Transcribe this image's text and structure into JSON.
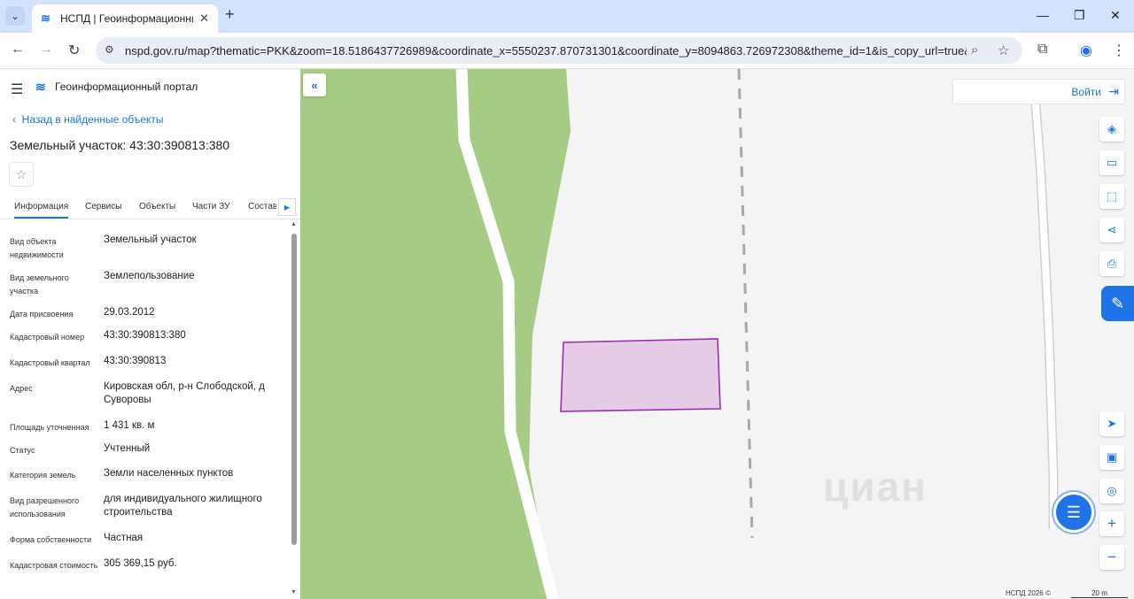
{
  "browser": {
    "tab_title": "НСПД | Геоинформационный",
    "url": "nspd.gov.ru/map?thematic=PKK&zoom=18.5186437726989&coordinate_x=5550237.870731301&coordinate_y=8094863.726972308&theme_id=1&is_copy_url=true&b..."
  },
  "header": {
    "portal_title": "Геоинформационный портал"
  },
  "panel": {
    "back_link": "Назад в найденные объекты",
    "object_title": "Земельный участок: 43:30:390813:380",
    "tabs": [
      "Информация",
      "Сервисы",
      "Объекты",
      "Части ЗУ",
      "Состав"
    ],
    "attributes": [
      {
        "key": "Вид объекта недвижимости",
        "value": "Земельный участок"
      },
      {
        "key": "Вид земельного участка",
        "value": "Землепользование"
      },
      {
        "key": "Дата присвоения",
        "value": "29.03.2012"
      },
      {
        "key": "Кадастровый номер",
        "value": "43:30:390813:380"
      },
      {
        "key": "Кадастровый квартал",
        "value": "43:30:390813"
      },
      {
        "key": "Адрес",
        "value": "Кировская обл, р-н Слободской, д Суворовы"
      },
      {
        "key": "Площадь уточненная",
        "value": "1 431 кв. м"
      },
      {
        "key": "Статус",
        "value": "Учтенный"
      },
      {
        "key": "Категория земель",
        "value": "Земли населенных пунктов"
      },
      {
        "key": "Вид разрешенного использования",
        "value": "для индивидуального жилищного строительства"
      },
      {
        "key": "Форма собственности",
        "value": "Частная"
      },
      {
        "key": "Кадастровая стоимость",
        "value": "305 369,15 руб."
      }
    ]
  },
  "map": {
    "login_label": "Войти",
    "watermark": "циан",
    "attribution": "НСПД 2026 ©",
    "scale_label": "20 m",
    "colors": {
      "forest": "#a6cb85",
      "parcel_fill": "#e6cbe6",
      "parcel_stroke": "#9b2fae",
      "accent": "#1e73e8"
    }
  }
}
